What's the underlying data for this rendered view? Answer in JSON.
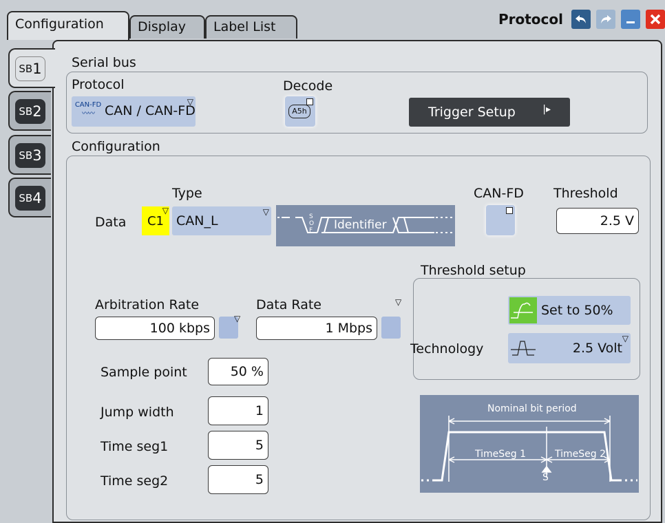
{
  "tabs": [
    {
      "label": "Configuration"
    },
    {
      "label": "Display"
    },
    {
      "label": "Label List"
    }
  ],
  "window": {
    "title": "Protocol"
  },
  "side_tabs": [
    {
      "prefix": "SB",
      "num": "1"
    },
    {
      "prefix": "SB",
      "num": "2"
    },
    {
      "prefix": "SB",
      "num": "3"
    },
    {
      "prefix": "SB",
      "num": "4"
    }
  ],
  "serial_bus": {
    "section_label": "Serial bus",
    "protocol_label": "Protocol",
    "protocol_icon_text": "CAN-FD",
    "protocol_value": "CAN / CAN-FD",
    "decode_label": "Decode",
    "decode_icon_text": "A5h",
    "trigger_setup_label": "Trigger Setup"
  },
  "configuration": {
    "section_label": "Configuration",
    "type_label": "Type",
    "data_label": "Data",
    "source_value": "C1",
    "type_value": "CAN_L",
    "frame_diagram": {
      "sof_text": "SOF",
      "identifier_text": "Identifier"
    },
    "canfd_label": "CAN-FD",
    "threshold_label": "Threshold",
    "threshold_value": "2.5 V",
    "threshold_setup": {
      "label": "Threshold setup",
      "set50_label": "Set to 50%",
      "technology_label": "Technology",
      "technology_value": "2.5 Volt"
    },
    "arbitration_rate_label": "Arbitration Rate",
    "arbitration_rate_value": "100 kbps",
    "data_rate_label": "Data Rate",
    "data_rate_value": "1 Mbps",
    "sample_point_label": "Sample point",
    "sample_point_value": "50 %",
    "jump_width_label": "Jump width",
    "jump_width_value": "1",
    "time_seg1_label": "Time seg1",
    "time_seg1_value": "5",
    "time_seg2_label": "Time seg2",
    "time_seg2_value": "5",
    "bit_diagram": {
      "nominal_label": "Nominal bit period",
      "seg1_label": "TimeSeg 1",
      "seg2_label": "TimeSeg 2",
      "sample_label": "S"
    }
  },
  "colors": {
    "background": "#c9ced3",
    "panel": "#dfe2e5",
    "combo_blue": "#b9c8e2",
    "diagram": "#7e8ea9",
    "source_yellow": "#ffff00",
    "close_red": "#e03020",
    "trigger_button": "#3c3f43"
  }
}
